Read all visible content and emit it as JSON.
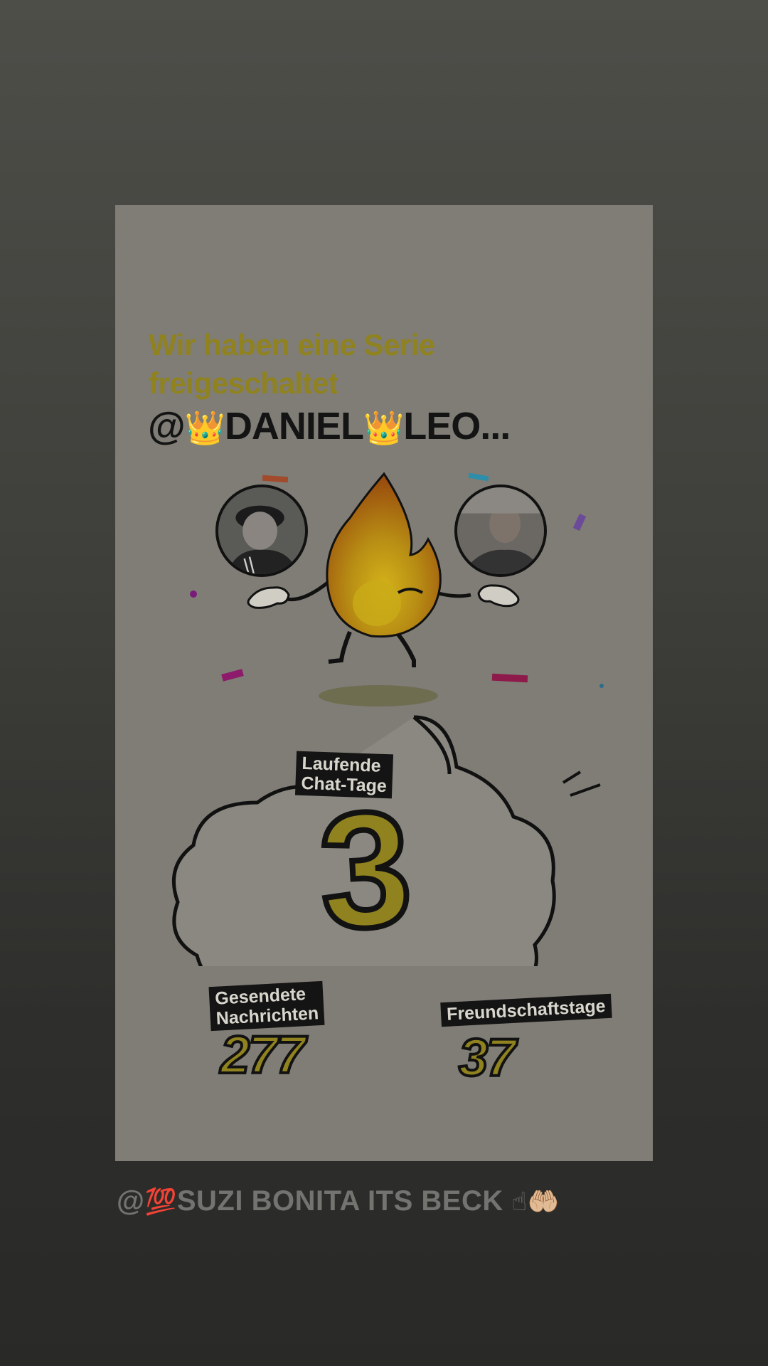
{
  "story": {
    "headline": "Wir haben eine Serie freigeschaltet",
    "mention_prefix": "@",
    "mention_crown": "👑",
    "mention_name_1": "DANIEL",
    "mention_name_2": "LEO..."
  },
  "stats": {
    "running_days_label_line1": "Laufende",
    "running_days_label_line2": "Chat-Tage",
    "running_days_value": "3",
    "messages_label_line1": "Gesendete",
    "messages_label_line2": "Nachrichten",
    "messages_value": "277",
    "friendship_label": "Freundschaftstage",
    "friendship_value": "37"
  },
  "caption": {
    "prefix": "@",
    "emoji_hundred": "💯",
    "text": "SUZI BONITA ITS BECK",
    "emoji_end": "☝🤲🏼"
  },
  "colors": {
    "accent": "#8f821f",
    "card": "#7f7d75",
    "flame_outer": "#b86d12",
    "flame_inner": "#c9a514"
  }
}
